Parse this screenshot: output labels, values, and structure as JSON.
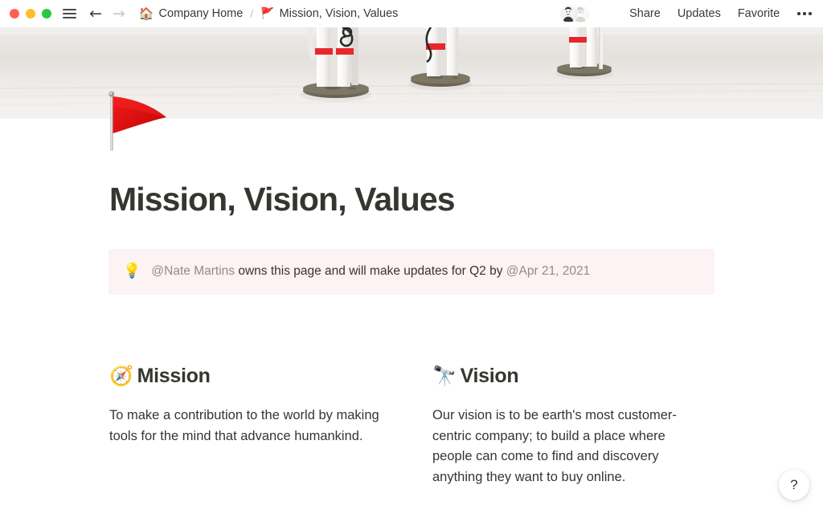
{
  "window": {
    "traffic_lights": [
      {
        "name": "close",
        "color": "#ff5f57"
      },
      {
        "name": "minimize",
        "color": "#febc2e"
      },
      {
        "name": "maximize",
        "color": "#28c840"
      }
    ],
    "sidebar_toggle": "menu-icon",
    "back_label": "←",
    "forward_label": "→"
  },
  "breadcrumb": {
    "separator": "/",
    "items": [
      {
        "icon": "🏠",
        "icon_name": "house-emoji",
        "label": "Company Home"
      },
      {
        "icon": "🚩",
        "icon_name": "triangular-flag-emoji",
        "label": "Mission, Vision, Values"
      }
    ]
  },
  "topbar_actions": {
    "share_label": "Share",
    "updates_label": "Updates",
    "favorite_label": "Favorite",
    "more_label": "•••",
    "collaborators": [
      {
        "name": "avatar-nate"
      },
      {
        "name": "avatar-second-user"
      }
    ]
  },
  "cover": {
    "alt": "astronaut figurines on a white surface",
    "background_color": "#e8e5e1"
  },
  "page": {
    "icon": "🚩",
    "icon_name": "triangular-flag-emoji",
    "title": "Mission, Vision, Values"
  },
  "callout": {
    "icon": "💡",
    "icon_name": "light-bulb-emoji",
    "background_color": "#fdf2f4",
    "mention_color": "#908d88",
    "mention_user": "@Nate Martins",
    "text_middle": " owns this page and will make updates for Q2 by ",
    "mention_date": "@Apr 21, 2021"
  },
  "columns": [
    {
      "icon": "🧭",
      "icon_name": "compass-emoji",
      "heading": "Mission",
      "body": "To make a contribution to the world by making tools for the mind that advance humankind."
    },
    {
      "icon": "🔭",
      "icon_name": "telescope-emoji",
      "heading": "Vision",
      "body": "Our vision is to be earth's most customer-centric company; to build a place where people can come to find and discovery anything they want to buy online."
    }
  ],
  "help_button": {
    "label": "?"
  }
}
